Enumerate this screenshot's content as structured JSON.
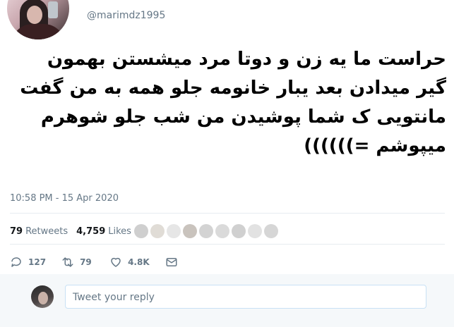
{
  "user": {
    "handle": "@marimdz1995"
  },
  "tweet": {
    "text": "حراست ما یه زن و دوتا مرد میشستن بهمون گیر میدادن بعد یبار خانومه جلو همه به من گفت مانتویی ک شما پوشیدن من شب جلو شوهرم میپوشم =))))))",
    "timestamp": "10:58 PM - 15 Apr 2020"
  },
  "stats": {
    "retweets_count": "79",
    "retweets_label": "Retweets",
    "likes_count": "4,759",
    "likes_label": "Likes"
  },
  "actions": {
    "replies": "127",
    "retweets": "79",
    "likes": "4.8K"
  },
  "reply": {
    "placeholder": "Tweet your reply"
  }
}
